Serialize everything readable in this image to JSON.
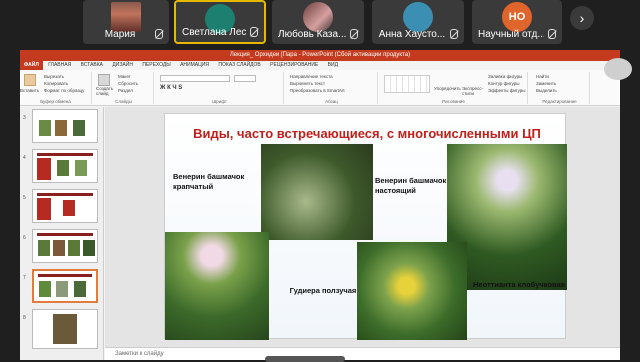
{
  "participants": [
    {
      "name": "Мария",
      "avatar": "img"
    },
    {
      "name": "Светлана Лесина",
      "avatar": "green",
      "active": true
    },
    {
      "name": "Любовь Каза...",
      "avatar": "photo"
    },
    {
      "name": "Анна Хаусто...",
      "avatar": "teal"
    },
    {
      "name": "Научный отд...",
      "avatar": "orange",
      "initials": "НО"
    }
  ],
  "next_glyph": "›",
  "ppt": {
    "window_title": "Лекция_ Орхидеи [Пара - PowerPoint (Сбой активации продукта)",
    "tabs": [
      "ФАЙЛ",
      "ГЛАВНАЯ",
      "ВСТАВКА",
      "ДИЗАЙН",
      "ПЕРЕХОДЫ",
      "АНИМАЦИЯ",
      "ПОКАЗ СЛАЙДОВ",
      "РЕЦЕНЗИРОВАНИЕ",
      "ВИД"
    ],
    "ribbon": {
      "clipboard": {
        "paste": "Вставить",
        "cut": "Вырезать",
        "copy": "Копировать",
        "format": "Формат по образцу",
        "label": "Буфер обмена"
      },
      "slides": {
        "create": "Создать слайд",
        "layout": "Макет",
        "reset": "Сбросить",
        "section": "Раздел",
        "label": "Слайды"
      },
      "font": {
        "label": "Шрифт"
      },
      "paragraph": {
        "direction": "Направление текста",
        "align": "Выровнять текст",
        "smartart": "Преобразовать в SmartArt",
        "label": "Абзац"
      },
      "drawing": {
        "arrange": "Упорядочить",
        "styles": "Экспресс-стили",
        "fill": "Заливка фигуры",
        "outline": "Контур фигуры",
        "effects": "Эффекты фигуры",
        "label": "Рисование"
      },
      "editing": {
        "find": "Найти",
        "replace": "Заменить",
        "select": "Выделить",
        "label": "Редактирование"
      }
    },
    "thumbnails": [
      {
        "num": "3"
      },
      {
        "num": "4"
      },
      {
        "num": "5"
      },
      {
        "num": "6"
      },
      {
        "num": "7",
        "selected": true
      },
      {
        "num": "8"
      }
    ],
    "slide": {
      "title": "Виды, часто встречающиеся, с многочисленными ЦП",
      "captions": {
        "c1": "Венерин башмачок крапчатый",
        "c2": "Венерин башмачок настоящий",
        "c3": "Гудиера ползучая",
        "c4": "Неоттианта клобучковая"
      }
    },
    "notes_placeholder": "Заметки к слайду"
  }
}
